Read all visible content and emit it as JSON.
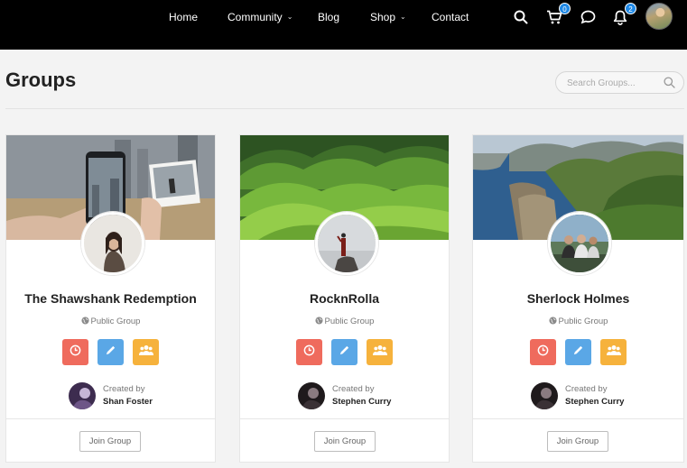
{
  "nav": {
    "items": [
      {
        "label": "Home",
        "has_dropdown": false
      },
      {
        "label": "Community",
        "has_dropdown": true
      },
      {
        "label": "Blog",
        "has_dropdown": false
      },
      {
        "label": "Shop",
        "has_dropdown": true
      },
      {
        "label": "Contact",
        "has_dropdown": false
      }
    ],
    "cart_count": "0",
    "notification_count": "2",
    "icons": [
      "search-icon",
      "cart-icon",
      "chat-icon",
      "bell-icon",
      "user-avatar"
    ]
  },
  "page": {
    "title": "Groups",
    "search_placeholder": "Search Groups..."
  },
  "groups": [
    {
      "name": "The Shawshank Redemption",
      "type": "Public Group",
      "created_by_label": "Created by",
      "creator": "Shan Foster",
      "join_label": "Join Group"
    },
    {
      "name": "RocknRolla",
      "type": "Public Group",
      "created_by_label": "Created by",
      "creator": "Stephen Curry",
      "join_label": "Join Group"
    },
    {
      "name": "Sherlock Holmes",
      "type": "Public Group",
      "created_by_label": "Created by",
      "creator": "Stephen Curry",
      "join_label": "Join Group"
    }
  ],
  "colors": {
    "header_bg": "#000000",
    "page_bg": "#f3f3f3",
    "action_red": "#ef6b5d",
    "action_blue": "#5aa7e6",
    "action_yellow": "#f6b23c",
    "badge_blue": "#1e88e5"
  }
}
